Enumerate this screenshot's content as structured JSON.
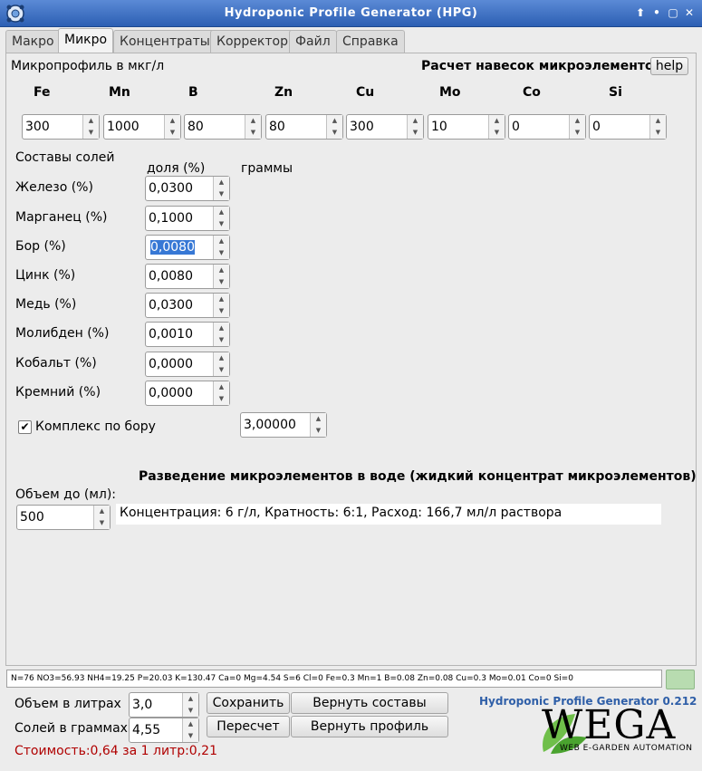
{
  "window": {
    "title": "Hydroponic Profile Generator (HPG)",
    "controls": [
      "⬆",
      "•",
      "▢",
      "✕"
    ]
  },
  "tabs": [
    "Макро",
    "Микро",
    "Концентраты",
    "Корректор",
    "Файл",
    "Справка"
  ],
  "micro": {
    "profile_label": "Микропрофиль в мкг/л",
    "calc_title": "Расчет навесок микроэлементов",
    "help_label": "help",
    "elements": [
      {
        "symbol": "Fe",
        "value": "300"
      },
      {
        "symbol": "Mn",
        "value": "1000"
      },
      {
        "symbol": "B",
        "value": "80"
      },
      {
        "symbol": "Zn",
        "value": "80"
      },
      {
        "symbol": "Cu",
        "value": "300"
      },
      {
        "symbol": "Mo",
        "value": "10"
      },
      {
        "symbol": "Co",
        "value": "0"
      },
      {
        "symbol": "Si",
        "value": "0"
      }
    ],
    "salts_title": "Составы солей",
    "col_share": "доля (%)",
    "col_grams": "граммы",
    "salts": [
      {
        "label": "Железо (%)",
        "value": "0,0300"
      },
      {
        "label": "Марганец (%)",
        "value": "0,1000"
      },
      {
        "label": "Бор (%)",
        "value": "0,0080"
      },
      {
        "label": "Цинк (%)",
        "value": "0,0080"
      },
      {
        "label": "Медь (%)",
        "value": "0,0300"
      },
      {
        "label": "Молибден (%)",
        "value": "0,0010"
      },
      {
        "label": "Кобальт (%)",
        "value": "0,0000"
      },
      {
        "label": "Кремний (%)",
        "value": "0,0000"
      }
    ],
    "complex_boron_label": "Комплекс по бору",
    "complex_boron_checked": true,
    "complex_boron_value": "3,00000",
    "dilution_title": "Разведение микроэлементов в воде (жидкий концентрат микроэлементов)",
    "volume_label": "Объем до (мл):",
    "volume_value": "500",
    "dilution_result": "Концентрация: 6 г/л, Кратность: 6:1, Расход: 166,7 мл/л раствора"
  },
  "status_line": "N=76 NO3=56.93 NH4=19.25 P=20.03 K=130.47 Ca=0 Mg=4.54 S=6 Cl=0 Fe=0.3 Mn=1 B=0.08 Zn=0.08 Cu=0.3 Mo=0.01 Co=0 Si=0",
  "bottom": {
    "liters_label": "Объем в литрах",
    "liters_value": "3,0",
    "grams_label": "Солей в граммах:",
    "grams_value": "4,55",
    "save_label": "Сохранить",
    "recalc_label": "Пересчет",
    "restore_comp_label": "Вернуть составы",
    "restore_profile_label": "Вернуть профиль",
    "version_label": "Hydroponic Profile Generator 0.212",
    "cost_label": "Стоимость:0,64 за 1 литр:0,21",
    "logo_text": "WEGA",
    "logo_subtext": "WEB E-GARDEN AUTOMATION"
  },
  "colors": {
    "titlebar": "#2c5fb3",
    "version_text": "#2f5fa8",
    "cost_text": "#b00000",
    "selection": "#3778d5",
    "status_indicator": "#b8dcb0"
  }
}
